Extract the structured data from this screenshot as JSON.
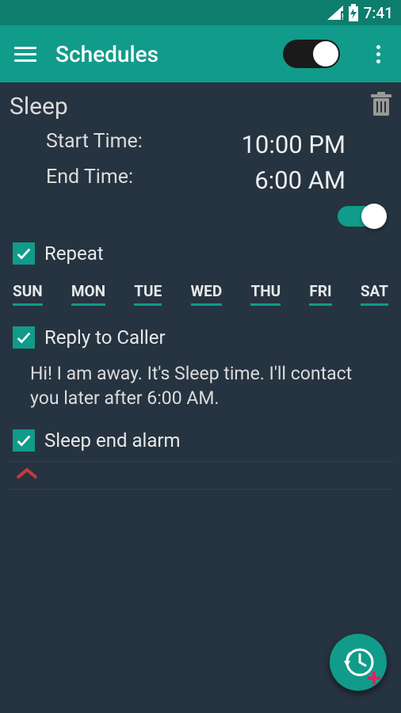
{
  "status": {
    "time": "7:41"
  },
  "app": {
    "title": "Schedules",
    "master_toggle_on": true
  },
  "schedule": {
    "name": "Sleep",
    "start_label": "Start Time:",
    "start_value": "10:00 PM",
    "end_label": "End Time:",
    "end_value": "6:00 AM",
    "enabled": true,
    "repeat": {
      "checked": true,
      "label": "Repeat"
    },
    "days": [
      "SUN",
      "MON",
      "TUE",
      "WED",
      "THU",
      "FRI",
      "SAT"
    ],
    "reply": {
      "checked": true,
      "label": "Reply to Caller",
      "message": "Hi! I am away. It's Sleep time. I'll contact you later after 6:00 AM."
    },
    "alarm": {
      "checked": true,
      "label": "Sleep end alarm"
    }
  },
  "colors": {
    "accent": "#119b8a",
    "accent_dark": "#0d7d6e",
    "bg": "#263340",
    "danger": "#c83a3a"
  }
}
